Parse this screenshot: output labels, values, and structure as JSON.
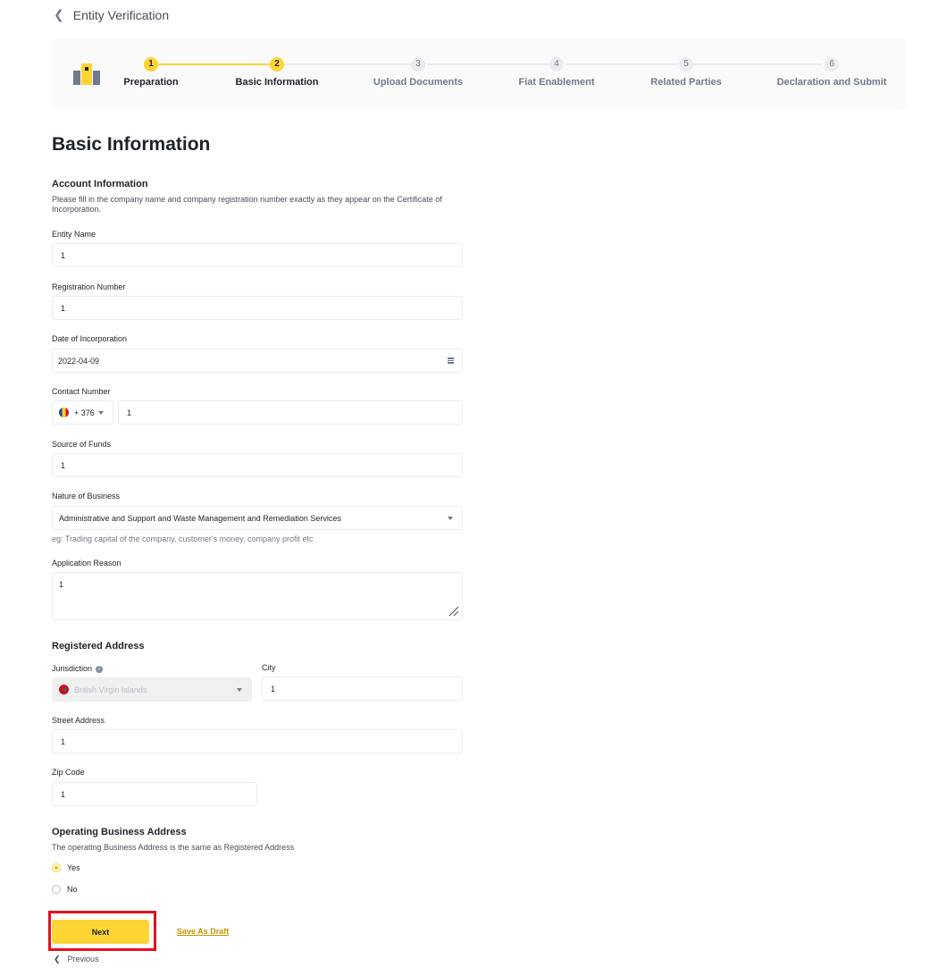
{
  "header": {
    "back_icon": "chevron-left-icon",
    "title": "Entity Verification"
  },
  "stepper": {
    "steps": [
      {
        "num": "1",
        "label": "Preparation",
        "state": "done"
      },
      {
        "num": "2",
        "label": "Basic Information",
        "state": "active"
      },
      {
        "num": "3",
        "label": "Upload Documents",
        "state": "pending"
      },
      {
        "num": "4",
        "label": "Fiat Enablement",
        "state": "pending"
      },
      {
        "num": "5",
        "label": "Related Parties",
        "state": "pending"
      },
      {
        "num": "6",
        "label": "Declaration and Submit",
        "state": "pending"
      }
    ],
    "accent_color": "#fcd535"
  },
  "page_title": "Basic Information",
  "account_info": {
    "title": "Account Information",
    "description": "Please fill in the company name and company registration number exactly as they appear on the Certificate of Incorporation.",
    "entity_name": {
      "label": "Entity Name",
      "value": "1"
    },
    "registration_number": {
      "label": "Registration Number",
      "value": "1"
    },
    "date_of_incorporation": {
      "label": "Date of Incorporation",
      "value": "2022-04-09"
    },
    "contact_number": {
      "label": "Contact Number",
      "country_code": "+ 376",
      "value": "1"
    },
    "source_of_funds": {
      "label": "Source of Funds",
      "value": "1"
    },
    "nature_of_business": {
      "label": "Nature of Business",
      "value": "Administrative and Support and Waste Management and Remediation Services",
      "hint": "eg: Trading capital of the company, customer's money, company profit etc"
    },
    "application_reason": {
      "label": "Application Reason",
      "value": "1"
    }
  },
  "registered_address": {
    "title": "Registered Address",
    "jurisdiction": {
      "label": "Jurisdiction",
      "value": "British Virgin Islands"
    },
    "city": {
      "label": "City",
      "value": "1"
    },
    "street_address": {
      "label": "Street Address",
      "value": "1"
    },
    "zip_code": {
      "label": "Zip Code",
      "value": "1"
    }
  },
  "operating_address": {
    "title": "Operating Business Address",
    "question": "The operating Business Address is the same as Registered Address",
    "options": [
      {
        "label": "Yes",
        "checked": true
      },
      {
        "label": "No",
        "checked": false
      }
    ]
  },
  "actions": {
    "next": "Next",
    "save_draft": "Save As Draft",
    "previous": "Previous"
  }
}
